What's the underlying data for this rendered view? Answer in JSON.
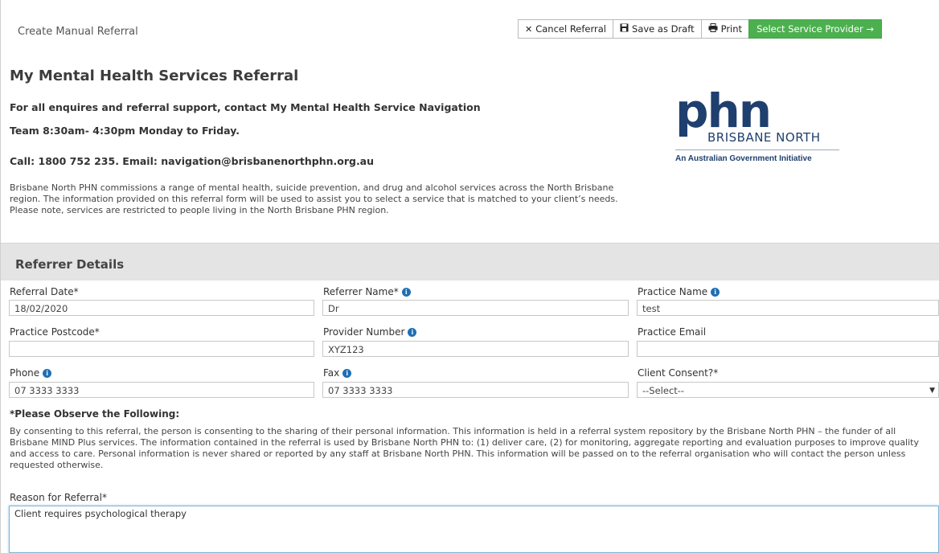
{
  "header": {
    "page_label": "Create Manual Referral",
    "cancel_label": "Cancel Referral",
    "save_label": "Save as Draft",
    "print_label": "Print",
    "select_label": "Select Service Provider →"
  },
  "intro": {
    "title": "My Mental Health Services Referral",
    "line1": "For all enquires and referral support, contact My Mental Health Service Navigation",
    "line2": "Team 8:30am- 4:30pm Monday to Friday.",
    "line3": "Call: 1800 752 235. Email: navigation@brisbanenorthphn.org.au",
    "paragraph": "Brisbane North PHN commissions a range of mental health, suicide prevention, and drug and alcohol services across the North Brisbane region.  The information provided on this referral form will be used to assist you to select a service that is matched to your client’s needs.  Please note, services are restricted to people living in the North Brisbane PHN region."
  },
  "logo": {
    "mark": "phn",
    "name": "BRISBANE NORTH",
    "tagline": "An Australian Government Initiative",
    "color": "#1f3f6e"
  },
  "referrer": {
    "section_title": "Referrer Details",
    "referral_date_label": "Referral Date*",
    "referral_date_value": "18/02/2020",
    "referrer_name_label": "Referrer Name*",
    "referrer_name_value": "Dr",
    "practice_name_label": "Practice Name",
    "practice_name_value": "test",
    "postcode_label": "Practice Postcode*",
    "postcode_value": "",
    "provider_number_label": "Provider Number",
    "provider_number_value": "XYZ123",
    "practice_email_label": "Practice Email",
    "practice_email_value": "",
    "phone_label": "Phone",
    "phone_value": "07 3333 3333",
    "fax_label": "Fax",
    "fax_value": "07 3333 3333",
    "consent_label": "Client Consent?*",
    "consent_value": "--Select--"
  },
  "observe": {
    "heading": "*Please Observe the Following:",
    "body": "By consenting to this referral, the person is consenting to the sharing of their personal information. This information is held in a referral system repository by the Brisbane North PHN – the funder of all Brisbane MIND Plus services. The information contained in the referral is used by Brisbane North PHN to: (1) deliver care, (2) for monitoring, aggregate reporting and evaluation purposes to improve quality and access to care. Personal information is never shared or reported by any staff at Brisbane North PHN. This information will be passed on to the referral organisation who will contact the person unless requested otherwise."
  },
  "reason": {
    "label": "Reason for Referral*",
    "value": "Client requires psychological therapy"
  },
  "colors": {
    "primary_button": "#4cb04f",
    "info_icon": "#1f6fb5",
    "section_band": "#e4e4e4"
  }
}
